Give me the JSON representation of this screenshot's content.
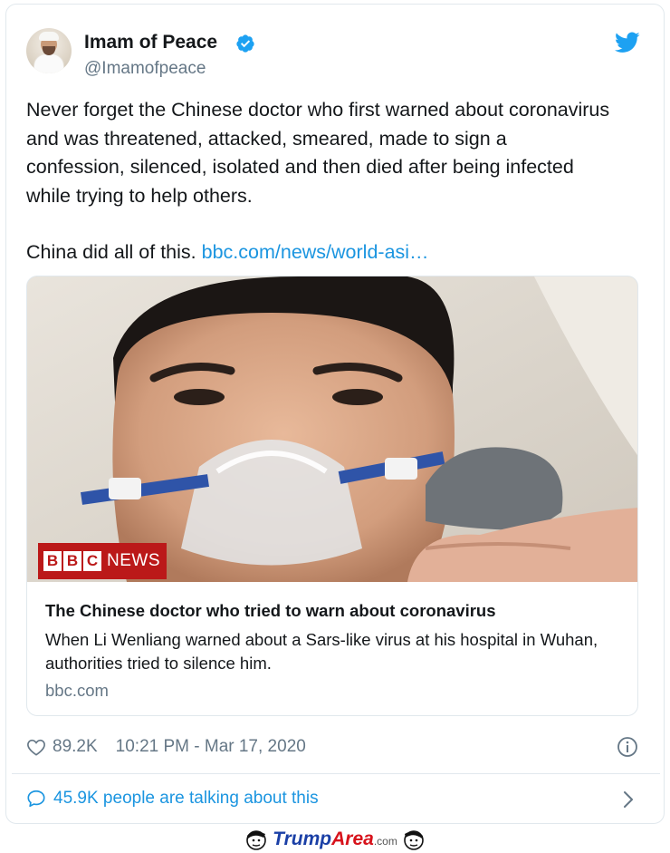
{
  "user": {
    "name": "Imam of Peace",
    "handle": "@Imamofpeace"
  },
  "tweet": {
    "lines": [
      "Never forget the Chinese doctor who first warned about coronavirus",
      "and was threatened, attacked, smeared, made to sign a",
      "confession, silenced, isolated and then died after being infected",
      "while trying to help others."
    ],
    "second_paragraph": "China did all of this.",
    "link_text": "bbc.com/news/world-asi…"
  },
  "card": {
    "badge_letters": [
      "B",
      "B",
      "C"
    ],
    "badge_news": "NEWS",
    "title": "The Chinese doctor who tried to warn about coronavirus",
    "description": "When Li Wenliang warned about a Sars-like virus at his hospital in Wuhan, authorities tried to silence him.",
    "domain": "bbc.com"
  },
  "stats": {
    "likes": "89.2K",
    "timestamp": "10:21 PM - Mar 17, 2020"
  },
  "talking": {
    "text": "45.9K people are talking about this"
  },
  "watermark": {
    "trump": "Trump",
    "area": "Area",
    "com": ".com"
  },
  "colors": {
    "link_blue": "#1b95e0",
    "muted_gray": "#657786",
    "bbc_red": "#bb1919",
    "text_dark": "#14171a"
  },
  "icons": [
    "verified-badge-icon",
    "twitter-bird-icon",
    "heart-icon",
    "info-icon",
    "speech-bubble-icon",
    "chevron-right-icon"
  ]
}
